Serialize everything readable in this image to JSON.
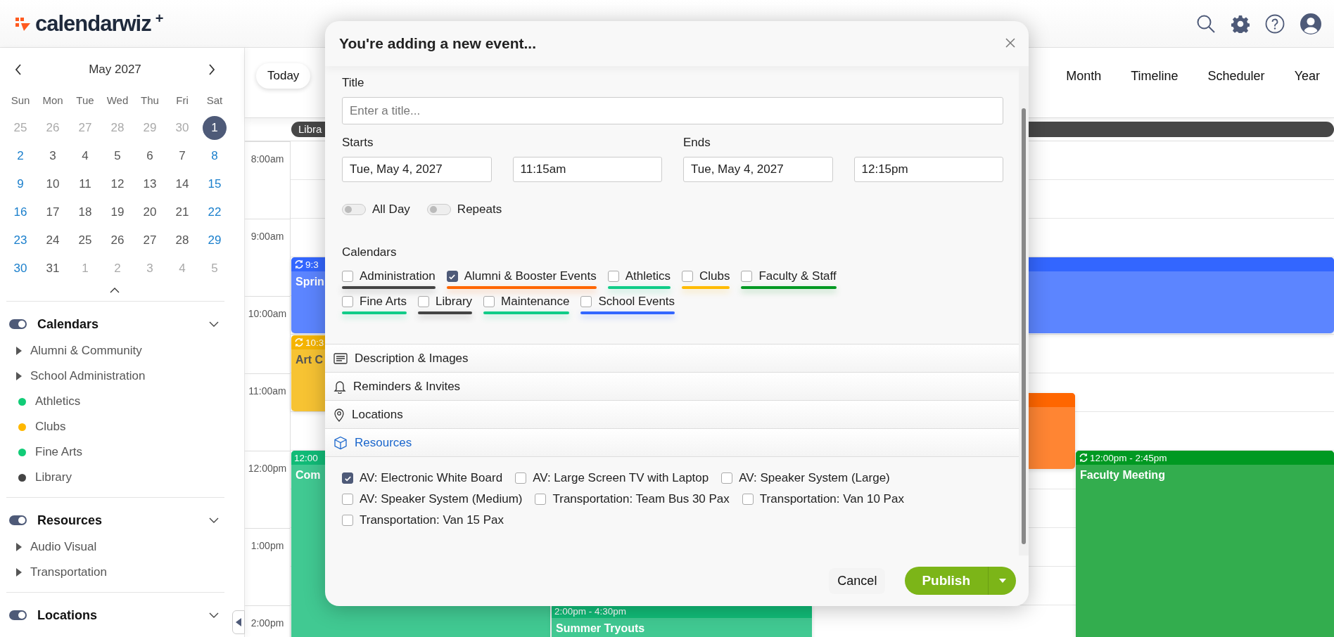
{
  "app": {
    "logo_text": "calendarwiz",
    "logo_plus": "+"
  },
  "mini_calendar": {
    "month": "May 2027",
    "weekdays": [
      "Sun",
      "Mon",
      "Tue",
      "Wed",
      "Thu",
      "Fri",
      "Sat"
    ],
    "weeks": [
      [
        {
          "day": "25",
          "muted": true,
          "selected": false
        },
        {
          "day": "26",
          "muted": true,
          "selected": false
        },
        {
          "day": "27",
          "muted": true,
          "selected": false
        },
        {
          "day": "28",
          "muted": true,
          "selected": false
        },
        {
          "day": "29",
          "muted": true,
          "selected": false
        },
        {
          "day": "30",
          "muted": true,
          "selected": false
        },
        {
          "day": "1",
          "muted": false,
          "selected": true
        }
      ],
      [
        {
          "day": "2",
          "muted": false,
          "selected": false
        },
        {
          "day": "3",
          "muted": false,
          "selected": false
        },
        {
          "day": "4",
          "muted": false,
          "selected": false
        },
        {
          "day": "5",
          "muted": false,
          "selected": false
        },
        {
          "day": "6",
          "muted": false,
          "selected": false
        },
        {
          "day": "7",
          "muted": false,
          "selected": false
        },
        {
          "day": "8",
          "muted": false,
          "selected": false
        }
      ],
      [
        {
          "day": "9",
          "muted": false,
          "selected": false
        },
        {
          "day": "10",
          "muted": false,
          "selected": false
        },
        {
          "day": "11",
          "muted": false,
          "selected": false
        },
        {
          "day": "12",
          "muted": false,
          "selected": false
        },
        {
          "day": "13",
          "muted": false,
          "selected": false
        },
        {
          "day": "14",
          "muted": false,
          "selected": false
        },
        {
          "day": "15",
          "muted": false,
          "selected": false
        }
      ],
      [
        {
          "day": "16",
          "muted": false,
          "selected": false
        },
        {
          "day": "17",
          "muted": false,
          "selected": false
        },
        {
          "day": "18",
          "muted": false,
          "selected": false
        },
        {
          "day": "19",
          "muted": false,
          "selected": false
        },
        {
          "day": "20",
          "muted": false,
          "selected": false
        },
        {
          "day": "21",
          "muted": false,
          "selected": false
        },
        {
          "day": "22",
          "muted": false,
          "selected": false
        }
      ],
      [
        {
          "day": "23",
          "muted": false,
          "selected": false
        },
        {
          "day": "24",
          "muted": false,
          "selected": false
        },
        {
          "day": "25",
          "muted": false,
          "selected": false
        },
        {
          "day": "26",
          "muted": false,
          "selected": false
        },
        {
          "day": "27",
          "muted": false,
          "selected": false
        },
        {
          "day": "28",
          "muted": false,
          "selected": false
        },
        {
          "day": "29",
          "muted": false,
          "selected": false
        }
      ],
      [
        {
          "day": "30",
          "muted": false,
          "selected": false
        },
        {
          "day": "31",
          "muted": false,
          "selected": false
        },
        {
          "day": "1",
          "muted": true,
          "selected": false
        },
        {
          "day": "2",
          "muted": true,
          "selected": false
        },
        {
          "day": "3",
          "muted": true,
          "selected": false
        },
        {
          "day": "4",
          "muted": true,
          "selected": false
        },
        {
          "day": "5",
          "muted": true,
          "selected": false
        }
      ]
    ]
  },
  "sidebar_sections": [
    {
      "title": "Calendars",
      "on": true,
      "expanded": true,
      "items": [
        {
          "label": "Alumni & Community",
          "kind": "group"
        },
        {
          "label": "School Administration",
          "kind": "group"
        },
        {
          "label": "Athletics",
          "kind": "calendar",
          "color": "#11cc77"
        },
        {
          "label": "Clubs",
          "kind": "calendar",
          "color": "#ffb800"
        },
        {
          "label": "Fine Arts",
          "kind": "calendar",
          "color": "#11cc77"
        },
        {
          "label": "Library",
          "kind": "calendar",
          "color": "#444444"
        }
      ]
    },
    {
      "title": "Resources",
      "on": true,
      "expanded": true,
      "items": [
        {
          "label": "Audio Visual",
          "kind": "group"
        },
        {
          "label": "Transportation",
          "kind": "group"
        }
      ]
    },
    {
      "title": "Locations",
      "on": true,
      "expanded": true
    }
  ],
  "toolbar": {
    "today": "Today",
    "views": [
      {
        "label": "Month",
        "selected": false
      },
      {
        "label": "Timeline",
        "selected": false
      },
      {
        "label": "Scheduler",
        "selected": false
      },
      {
        "label": "Year",
        "selected": false
      }
    ]
  },
  "all_day_events": [
    {
      "title": "Libra",
      "color": "#474747"
    }
  ],
  "time_labels": [
    "8:00am",
    "9:00am",
    "10:00am",
    "11:00am",
    "12:00pm",
    "1:00pm",
    "2:00pm"
  ],
  "events": [
    {
      "time": "9:3",
      "title": "Sprin",
      "recurring": true,
      "color": "#3366ff"
    },
    {
      "time": "10:3",
      "title": "Art C",
      "recurring": true,
      "color": "#f5b400"
    },
    {
      "color": "#ff6600"
    },
    {
      "time": "12:00",
      "title": "Com",
      "recurring": false,
      "color": "#11bb77"
    },
    {
      "time": "2:00pm - 4:30pm",
      "title": "Summer Tryouts",
      "recurring": false,
      "color": "#11bb77"
    },
    {
      "time": "12:00pm - 2:45pm",
      "title": "Faculty Meeting",
      "recurring": true,
      "color": "#009922"
    }
  ],
  "modal": {
    "title": "You're adding a new event...",
    "title_label": "Title",
    "title_placeholder": "Enter a title...",
    "starts_label": "Starts",
    "start_date": "Tue, May 4, 2027",
    "start_time": "11:15am",
    "ends_label": "Ends",
    "end_date": "Tue, May 4, 2027",
    "end_time": "12:15pm",
    "toggles": [
      {
        "label": "All Day",
        "on": false
      },
      {
        "label": "Repeats",
        "on": false
      }
    ],
    "calendars_label": "Calendars",
    "calendars": [
      {
        "label": "Administration",
        "checked": false,
        "color": "#444444"
      },
      {
        "label": "Alumni & Booster Events",
        "checked": true,
        "color": "#ff6600"
      },
      {
        "label": "Athletics",
        "checked": false,
        "color": "#11cc88"
      },
      {
        "label": "Clubs",
        "checked": false,
        "color": "#ffbb00"
      },
      {
        "label": "Faculty & Staff",
        "checked": false,
        "color": "#009922"
      },
      {
        "label": "Fine Arts",
        "checked": false,
        "color": "#11cc88"
      },
      {
        "label": "Library",
        "checked": false,
        "color": "#444444"
      },
      {
        "label": "Maintenance",
        "checked": false,
        "color": "#11cc88"
      },
      {
        "label": "School Events",
        "checked": false,
        "color": "#3366ff"
      }
    ],
    "sections": [
      {
        "label": "Description & Images",
        "kind": "description",
        "selected": false
      },
      {
        "label": "Reminders & Invites",
        "kind": "reminders",
        "selected": false
      },
      {
        "label": "Locations",
        "kind": "locations",
        "selected": false
      },
      {
        "label": "Resources",
        "kind": "resources",
        "selected": true
      }
    ],
    "resources": [
      {
        "label": "AV: Electronic White Board",
        "checked": true
      },
      {
        "label": "AV: Large Screen TV with Laptop",
        "checked": false
      },
      {
        "label": "AV: Speaker System (Large)",
        "checked": false
      },
      {
        "label": "AV: Speaker System (Medium)",
        "checked": false
      },
      {
        "label": "Transportation: Team Bus 30 Pax",
        "checked": false
      },
      {
        "label": "Transportation: Van 10 Pax",
        "checked": false
      },
      {
        "label": "Transportation: Van 15 Pax",
        "checked": false
      }
    ],
    "cancel": "Cancel",
    "publish": "Publish"
  }
}
